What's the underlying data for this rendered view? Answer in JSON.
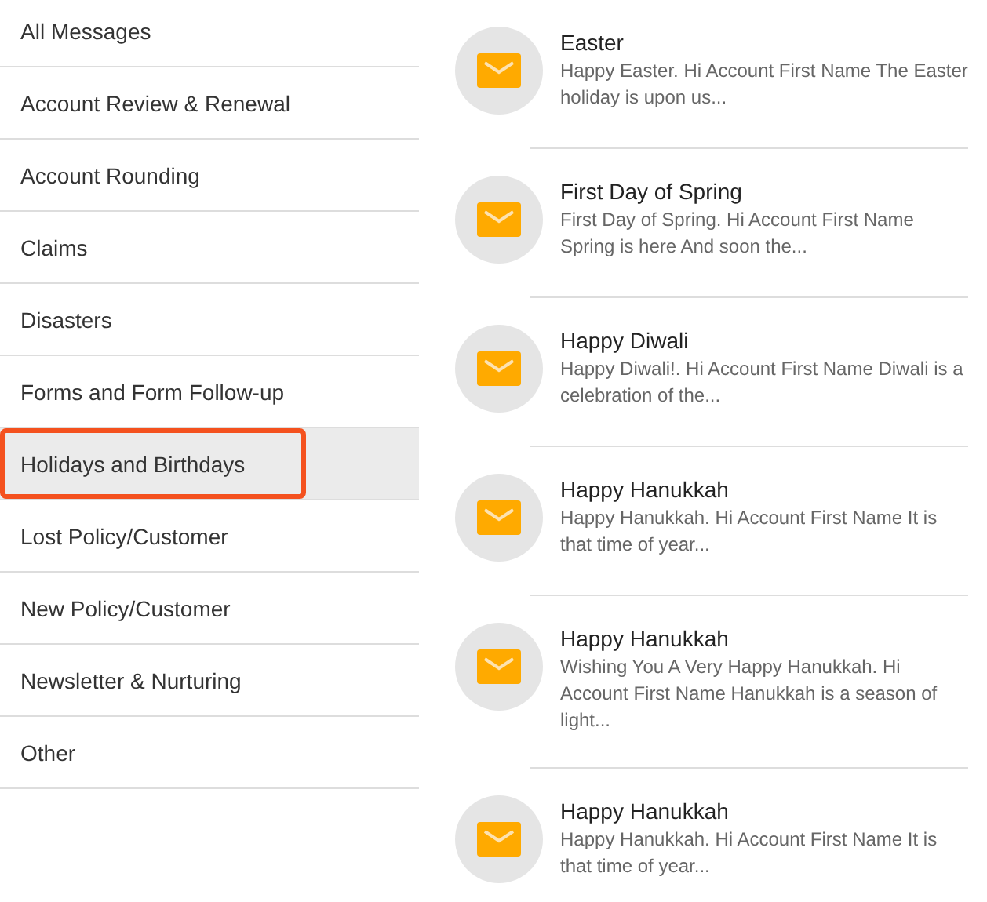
{
  "categories": [
    {
      "label": "All Messages",
      "selected": false
    },
    {
      "label": "Account Review & Renewal",
      "selected": false
    },
    {
      "label": "Account Rounding",
      "selected": false
    },
    {
      "label": "Claims",
      "selected": false
    },
    {
      "label": "Disasters",
      "selected": false
    },
    {
      "label": "Forms and Form Follow-up",
      "selected": false
    },
    {
      "label": "Holidays and Birthdays",
      "selected": true
    },
    {
      "label": "Lost Policy/Customer",
      "selected": false
    },
    {
      "label": "New Policy/Customer",
      "selected": false
    },
    {
      "label": "Newsletter & Nurturing",
      "selected": false
    },
    {
      "label": "Other",
      "selected": false
    }
  ],
  "messages": [
    {
      "title": "Easter",
      "preview": "Happy Easter. Hi Account First Name The Easter holiday is upon us..."
    },
    {
      "title": "First Day of Spring",
      "preview": "First Day of Spring. Hi Account First Name Spring is here And soon the..."
    },
    {
      "title": "Happy Diwali",
      "preview": "Happy Diwali!. Hi Account First Name Diwali is a celebration of the..."
    },
    {
      "title": "Happy Hanukkah",
      "preview": "Happy Hanukkah. Hi Account First Name It is that time of year..."
    },
    {
      "title": "Happy Hanukkah",
      "preview": "Wishing You A Very Happy Hanukkah. Hi Account First Name Hanukkah is a season of light..."
    },
    {
      "title": "Happy Hanukkah",
      "preview": "Happy Hanukkah. Hi Account First Name It is that time of year..."
    }
  ]
}
